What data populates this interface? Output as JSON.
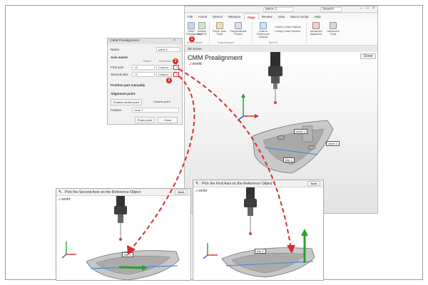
{
  "app": {
    "title": "piece 1",
    "search_placeholder": "Search",
    "menu": [
      "File",
      "Home",
      "Device",
      "Measure",
      "Align",
      "Review",
      "View",
      "Macro Script",
      "Help"
    ],
    "active_menu": "Align"
  },
  "ribbon": {
    "buttons": [
      {
        "label": "CMM Prealignment",
        "icon": "cmm-icon"
      },
      {
        "label": "Surface Best Fit",
        "icon": "surface-icon"
      },
      {
        "label": "Plane, Axis, Point",
        "icon": "plane-icon"
      },
      {
        "label": "Perpendicular Planes",
        "icon": "planes-icon"
      },
      {
        "label": "Data to Reference Objects",
        "icon": "data-ref-icon"
      },
      {
        "label": "Data to Data Objects",
        "icon": "data-data-icon"
      },
      {
        "label": "Using Cross Section",
        "icon": "cross-section-icon"
      },
      {
        "label": "Advanced Alignment",
        "icon": "advanced-icon"
      },
      {
        "label": "Advanced Tools",
        "icon": "tools-icon"
      }
    ],
    "groups": [
      "Best-fit Based",
      "Feature Based",
      "Best-Fit"
    ],
    "step_badge": "1"
  },
  "scene": {
    "tab": "3D Scene",
    "title": "CMM Prealignment",
    "close": "Close",
    "world": "world",
    "labels": [
      "circle 1",
      "circle 2",
      "line 1"
    ]
  },
  "dialog": {
    "header": "CMM Prealignment",
    "name_label": "Name",
    "name_value": "piece 1",
    "axis_match": "Axis match",
    "col_device": "Device",
    "col_reference": "Reference obj",
    "first_axis": "First axis",
    "second_axis": "Second axis",
    "first_device": "+Z",
    "second_device": "+X",
    "first_ref": "Custom",
    "second_ref": "Custom",
    "position_manually": "Position part manually",
    "alignment_point": "Alignment point",
    "feature_center_point": "Feature center point",
    "custom_point": "Custom point",
    "feature_label": "Feature",
    "feature_value": "circle 1",
    "probe_point": "Probe point",
    "close": "Close",
    "badges": [
      "2",
      "3"
    ]
  },
  "pick_second": {
    "title": "Pick the Second Axis on the Reference Object",
    "world": "world",
    "back": "Back",
    "label": "line 1"
  },
  "pick_first": {
    "title": "Pick the First Axis on the Reference Object",
    "world": "world",
    "back": "Back",
    "label": "line 1"
  },
  "colors": {
    "accent": "#c0272d",
    "arrow": "#d92b2b",
    "axis_green": "#2aa12a",
    "axis_blue": "#1f5bd6",
    "line_blue": "#4a90d9"
  }
}
